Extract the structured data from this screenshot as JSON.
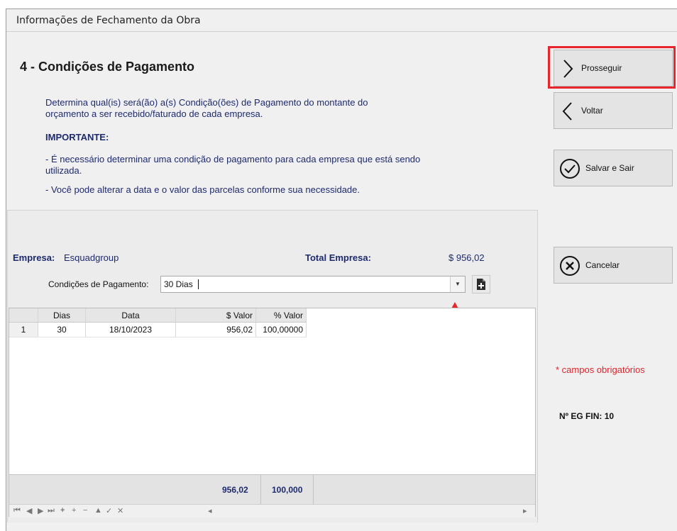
{
  "window": {
    "title": "Informações de Fechamento da Obra"
  },
  "section": {
    "title": "4 - Condições de Pagamento",
    "desc_line1": "Determina qual(is) será(ão) a(s) Condição(ões) de Pagamento do montante do",
    "desc_line2": "orçamento a ser recebido/faturado de cada empresa.",
    "important": "IMPORTANTE:",
    "note1_line1": "- É necessário determinar uma condição de pagamento para cada empresa que está sendo",
    "note1_line2": "utilizada.",
    "note2": "- Você pode alterar a data e o valor das parcelas conforme sua necessidade."
  },
  "empresa": {
    "label": "Empresa:",
    "value": "Esquadgroup",
    "total_label": "Total Empresa:",
    "total_value": "$ 956,02"
  },
  "condicoes": {
    "label": "Condições de Pagamento:",
    "value": "30 Dias"
  },
  "grid": {
    "headers": [
      "Dias",
      "Data",
      "$ Valor",
      "% Valor"
    ],
    "rows": [
      {
        "n": "1",
        "dias": "30",
        "data": "18/10/2023",
        "valor": "956,02",
        "perc": "100,00000"
      }
    ],
    "totals": {
      "valor": "956,02",
      "perc": "100,000"
    }
  },
  "buttons": {
    "prosseguir": "Prosseguir",
    "voltar": "Voltar",
    "salvar": "Salvar e Sair",
    "cancelar": "Cancelar"
  },
  "required_note": "* campos obrigatórios",
  "eg_fin": "Nº EG FIN: 10",
  "colors": {
    "text_blue": "#1e2a6e",
    "highlight": "#e8242c"
  },
  "icons": [
    "chevron-right-icon",
    "chevron-left-icon",
    "check-circle-icon",
    "x-circle-icon",
    "new-document-icon",
    "dropdown-arrow-icon",
    "red-arrow-icon"
  ]
}
